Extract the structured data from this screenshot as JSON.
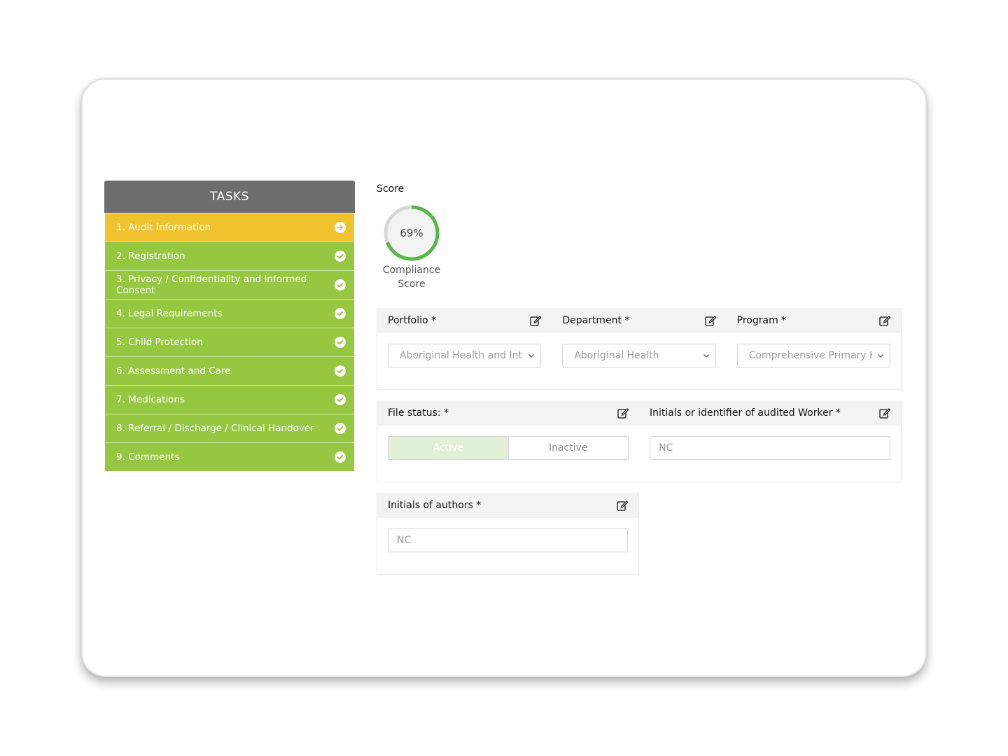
{
  "tasks": {
    "title": "TASKS",
    "items": [
      {
        "label": "1. Audit Information",
        "status": "active"
      },
      {
        "label": "2. Registration",
        "status": "done"
      },
      {
        "label": "3. Privacy / Confidentiality and Informed Consent",
        "status": "done"
      },
      {
        "label": "4. Legal Requirements",
        "status": "done"
      },
      {
        "label": "5. Child Protection",
        "status": "done"
      },
      {
        "label": "6. Assessment and Care",
        "status": "done"
      },
      {
        "label": "7. Medications",
        "status": "done"
      },
      {
        "label": "8. Referral / Discharge / Clinical Handover",
        "status": "done"
      },
      {
        "label": "9. Comments",
        "status": "done"
      }
    ]
  },
  "score": {
    "label": "Score",
    "value_text": "69%",
    "fraction": 0.69,
    "caption_line1": "Compliance",
    "caption_line2": "Score"
  },
  "org": {
    "portfolio": {
      "label": "Portfolio *",
      "value": "Aboriginal Health and Integ"
    },
    "department": {
      "label": "Department *",
      "value": "Aboriginal Health"
    },
    "program": {
      "label": "Program *",
      "value": "Comprehensive Primary He"
    }
  },
  "file_status": {
    "label": "File status: *",
    "active_label": "Active",
    "inactive_label": "Inactive",
    "selected": "Active"
  },
  "worker": {
    "label": "Initials or identifier of audited Worker *",
    "placeholder": "NC"
  },
  "authors": {
    "label": "Initials of authors *",
    "placeholder": "NC"
  },
  "colors": {
    "done": "#95c840",
    "active": "#f0c22d",
    "header": "#6d6d6d",
    "gauge": "#55b848",
    "gauge_track": "#d8d8d8"
  }
}
